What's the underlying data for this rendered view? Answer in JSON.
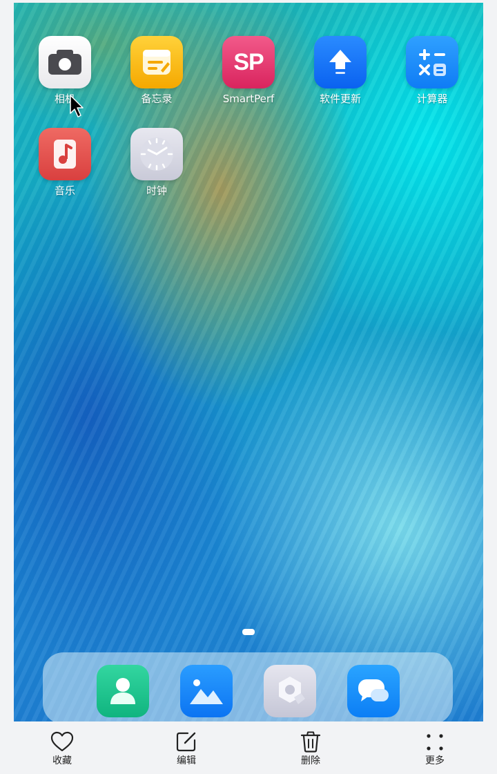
{
  "home_screen": {
    "apps": [
      {
        "label": "相机",
        "icon": "camera-icon"
      },
      {
        "label": "备忘录",
        "icon": "notepad-icon"
      },
      {
        "label": "SmartPerf",
        "icon": "smartperf-icon",
        "icon_text": "SP"
      },
      {
        "label": "软件更新",
        "icon": "software-update-icon"
      },
      {
        "label": "计算器",
        "icon": "calculator-icon"
      },
      {
        "label": "音乐",
        "icon": "music-icon"
      },
      {
        "label": "时钟",
        "icon": "clock-icon"
      }
    ],
    "page_indicator": {
      "pages": 1,
      "current": 1
    },
    "dock": [
      {
        "icon": "contacts-icon"
      },
      {
        "icon": "gallery-icon"
      },
      {
        "icon": "settings-icon"
      },
      {
        "icon": "messages-icon"
      }
    ]
  },
  "actions": [
    {
      "label": "收藏",
      "icon": "heart-icon"
    },
    {
      "label": "编辑",
      "icon": "edit-icon"
    },
    {
      "label": "删除",
      "icon": "trash-icon"
    },
    {
      "label": "更多",
      "icon": "more-icon"
    }
  ],
  "colors": {
    "notes": "#f5b400",
    "smartperf": "#e8336e",
    "update": "#1677ff",
    "calculator": "#1b8cff",
    "music": "#e2504e",
    "contacts": "#19c58c",
    "gallery": "#1a8cff",
    "messages": "#1c95ff",
    "action_text": "#222222"
  }
}
